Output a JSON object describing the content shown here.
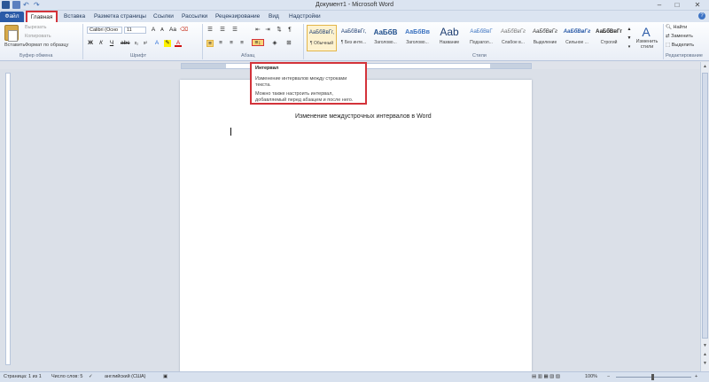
{
  "window": {
    "title": "Документ1 - Microsoft Word",
    "controls": [
      "–",
      "□",
      "✕"
    ]
  },
  "tabs": [
    {
      "label": "Файл"
    },
    {
      "label": "Главная"
    },
    {
      "label": "Вставка"
    },
    {
      "label": "Разметка страницы"
    },
    {
      "label": "Ссылки"
    },
    {
      "label": "Рассылки"
    },
    {
      "label": "Рецензирование"
    },
    {
      "label": "Вид"
    },
    {
      "label": "Надстройки"
    }
  ],
  "ribbon": {
    "clipboard": {
      "paste": "Вставить",
      "cut": "Вырезать",
      "copy": "Копировать",
      "format_painter": "Формат по образцу",
      "group_label": "Буфер обмена"
    },
    "font": {
      "font_name": "Calibri (Осно",
      "font_size": "11",
      "group_label": "Шрифт"
    },
    "paragraph": {
      "group_label": "Абзац"
    },
    "styles": {
      "items": [
        {
          "sample": "АаБбВвГг,",
          "name": "¶ Обычный"
        },
        {
          "sample": "АаБбВвГг,",
          "name": "¶ Без инте..."
        },
        {
          "sample": "АаБбВ",
          "name": "Заголово..."
        },
        {
          "sample": "АаБбВв",
          "name": "Заголово..."
        },
        {
          "sample": "Aab",
          "name": "Название"
        },
        {
          "sample": "АаБбВвГ",
          "name": "Подзагол..."
        },
        {
          "sample": "АаБбВвГг",
          "name": "Слабое в..."
        },
        {
          "sample": "АаБбВвГг",
          "name": "Выделение"
        },
        {
          "sample": "АаБбВвГг",
          "name": "Сильное ..."
        },
        {
          "sample": "АаБбВвГг",
          "name": "Строгий"
        }
      ],
      "change_styles": "Изменить стили",
      "group_label": "Стили"
    },
    "editing": {
      "find": "Найти",
      "replace": "Заменить",
      "select": "Выделить",
      "group_label": "Редактирование"
    }
  },
  "tooltip": {
    "title": "Интервал",
    "line1": "Изменение интервалов между строками текста.",
    "line2": "Можно также настроить интервал, добавляемый перед абзацем и после него."
  },
  "document": {
    "text": "Изменение междустрочных интервалов  в Word"
  },
  "statusbar": {
    "page": "Страница: 1 из 1",
    "words": "Число слов: 5",
    "language": "английский (США)",
    "zoom": "100%"
  }
}
